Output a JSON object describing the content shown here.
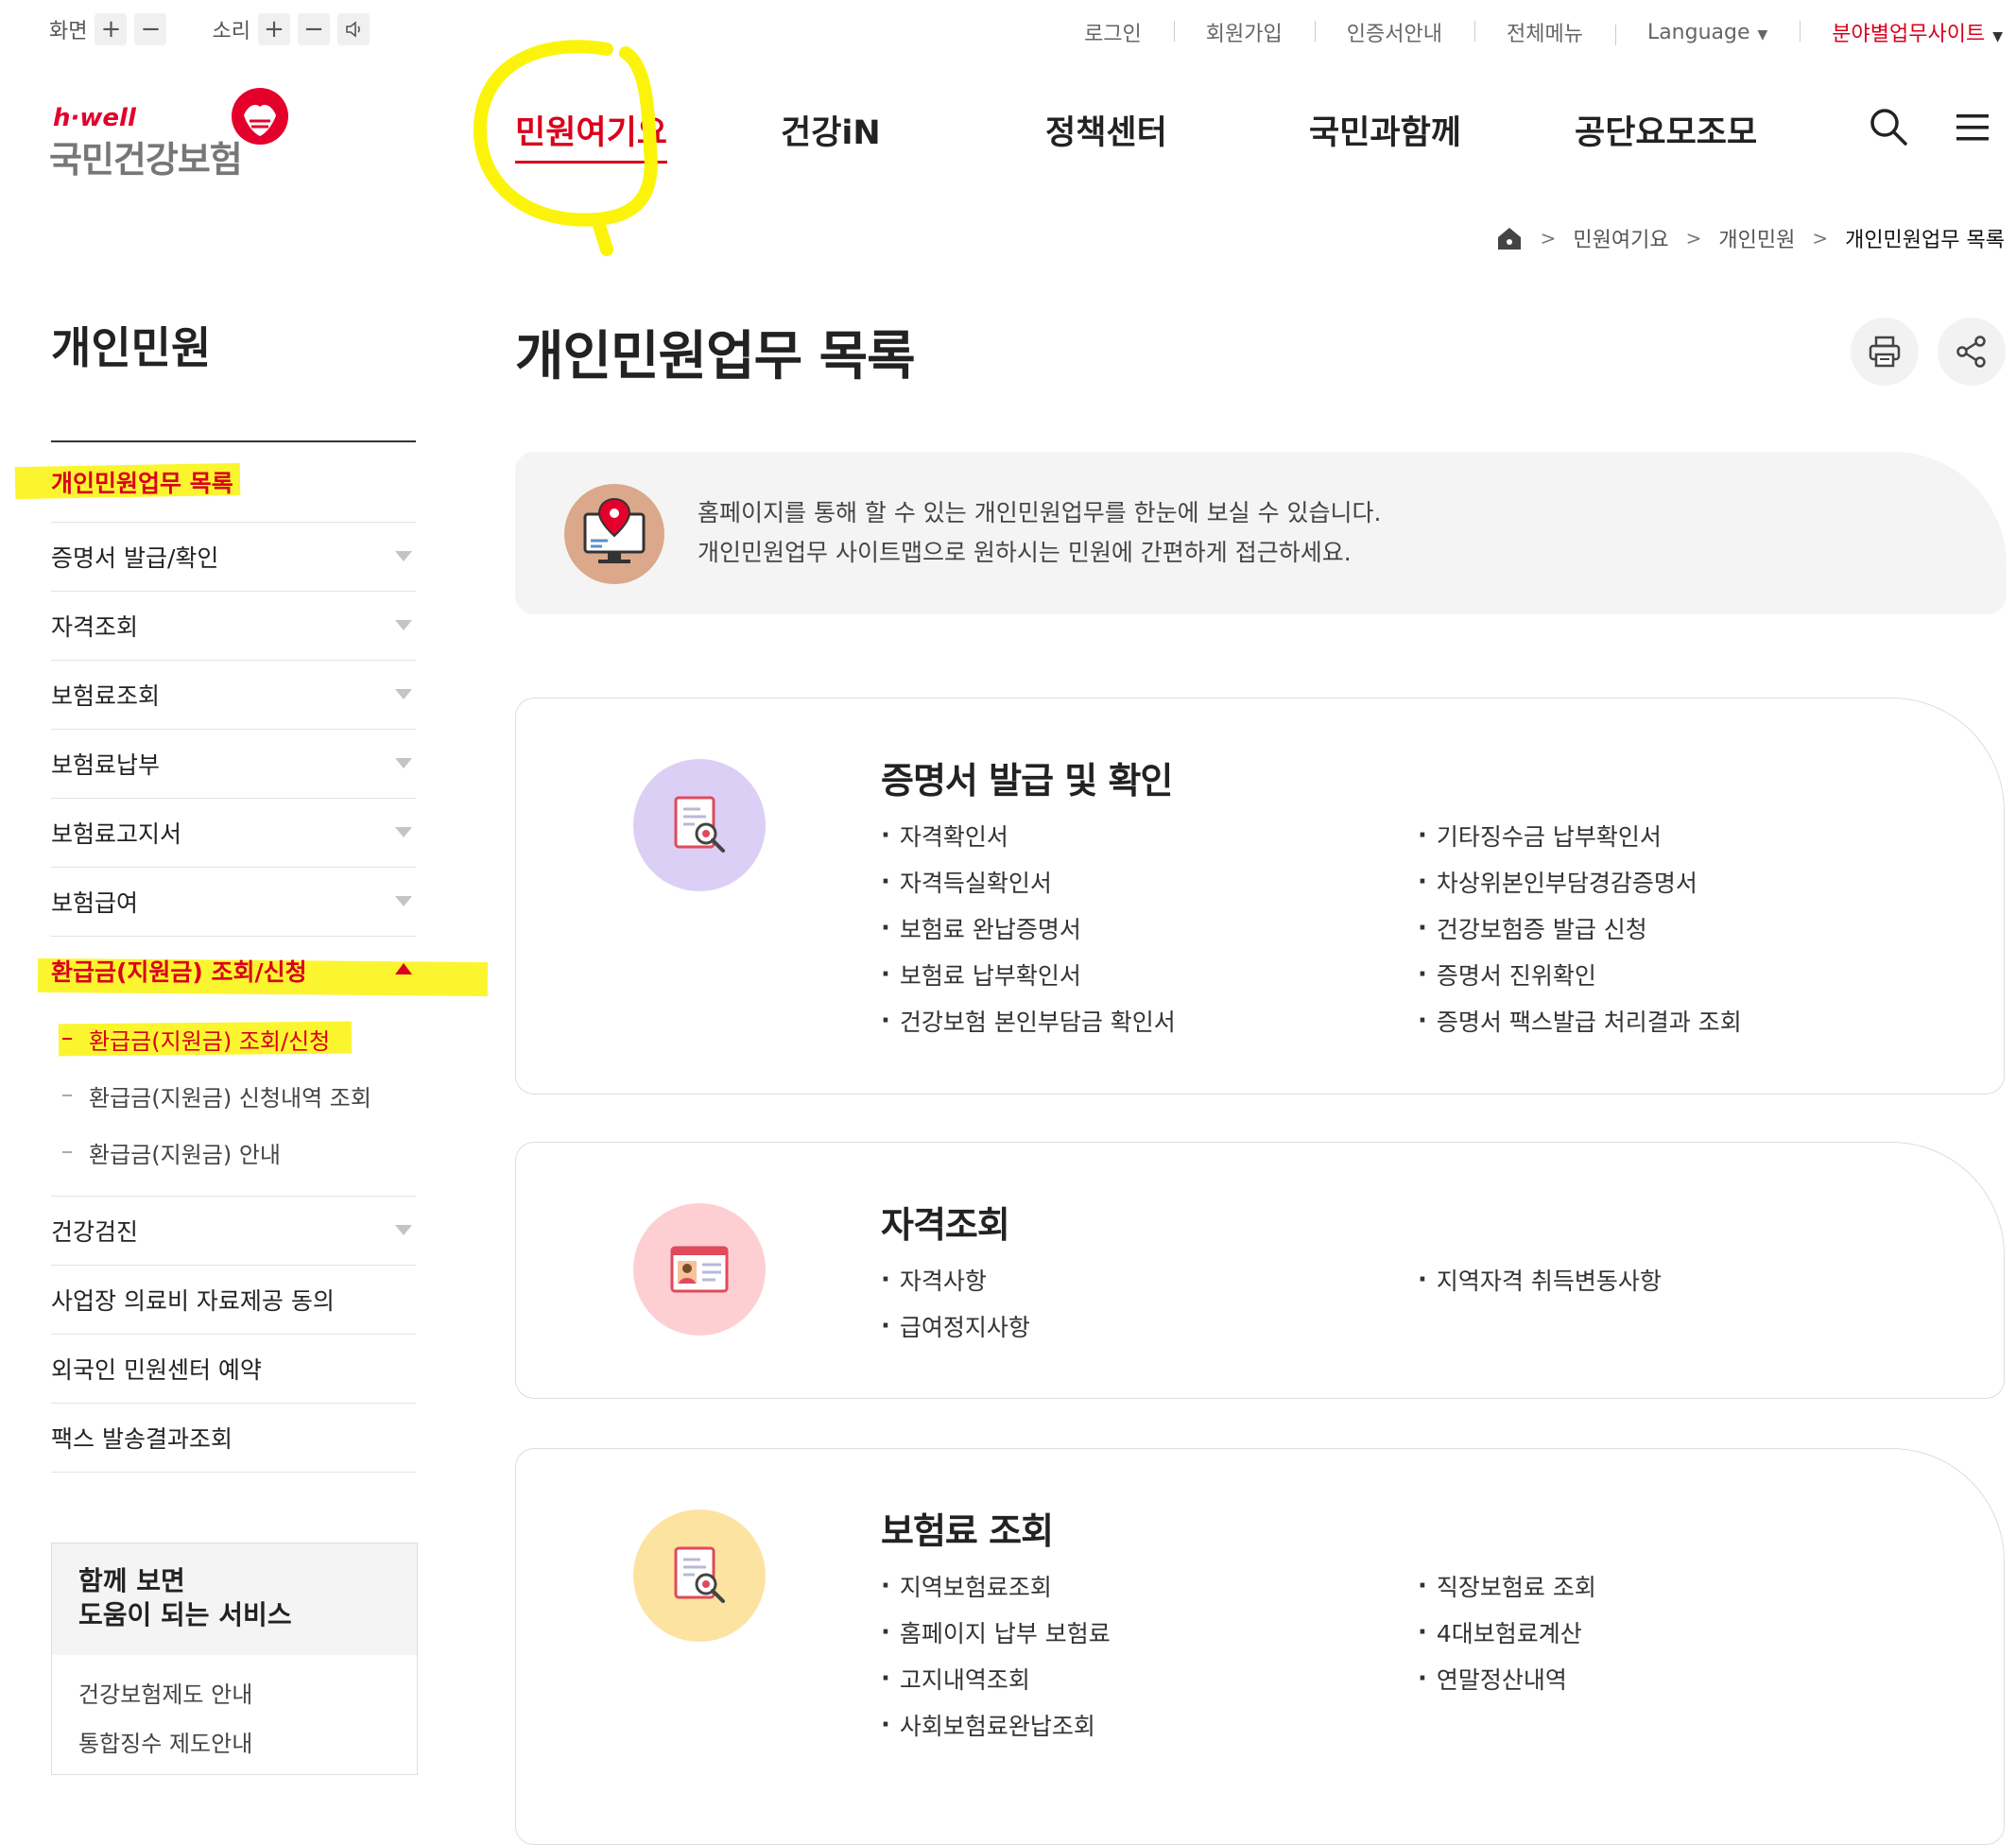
{
  "utility": {
    "screen_label": "화면",
    "sound_label": "소리",
    "links": [
      "로그인",
      "회원가입",
      "인증서안내",
      "전체메뉴"
    ],
    "language_label": "Language",
    "field_sites_label": "분야별업무사이트"
  },
  "logo": {
    "tagline": "h·well",
    "name": "국민건강보험"
  },
  "gnb": {
    "items": [
      "민원여기요",
      "건강iN",
      "정책센터",
      "국민과함께",
      "공단요모조모"
    ],
    "active_index": 0
  },
  "breadcrumb": {
    "items": [
      "민원여기요",
      "개인민원",
      "개인민원업무 목록"
    ]
  },
  "sidebar": {
    "title": "개인민원",
    "items": [
      {
        "label": "개인민원업무 목록",
        "active": true
      },
      {
        "label": "증명서 발급/확인"
      },
      {
        "label": "자격조회"
      },
      {
        "label": "보험료조회"
      },
      {
        "label": "보험료납부"
      },
      {
        "label": "보험료고지서"
      },
      {
        "label": "보험급여"
      },
      {
        "label": "환급금(지원금) 조회/신청",
        "expanded": true
      },
      {
        "label": "건강검진"
      },
      {
        "label": "사업장 의료비 자료제공 동의"
      },
      {
        "label": "외국인 민원센터 예약"
      },
      {
        "label": "팩스 발송결과조회"
      }
    ],
    "subitems": [
      "환급금(지원금) 조회/신청",
      "환급금(지원금) 신청내역 조회",
      "환급금(지원금) 안내"
    ],
    "related": {
      "title_line1": "함께 보면",
      "title_line2": "도움이 되는 서비스",
      "links": [
        "건강보험제도 안내",
        "통합징수 제도안내"
      ]
    }
  },
  "main": {
    "page_title": "개인민원업무 목록",
    "intro_line1": "홈페이지를 통해 할 수 있는 개인민원업무를 한눈에 보실 수 있습니다.",
    "intro_line2": "개인민원업무 사이트맵으로 원하시는 민원에 간편하게 접근하세요.",
    "cards": [
      {
        "title": "증명서 발급 및 확인",
        "icon": "certificate-search-icon",
        "col1": [
          "자격확인서",
          "자격득실확인서",
          "보험료 완납증명서",
          "보험료 납부확인서",
          "건강보험 본인부담금 확인서"
        ],
        "col2": [
          "기타징수금 납부확인서",
          "차상위본인부담경감증명서",
          "건강보험증 발급 신청",
          "증명서 진위확인",
          "증명서 팩스발급 처리결과 조회"
        ]
      },
      {
        "title": "자격조회",
        "icon": "id-card-icon",
        "col1": [
          "자격사항",
          "급여정지사항"
        ],
        "col2": [
          "지역자격 취득변동사항"
        ]
      },
      {
        "title": "보험료 조회",
        "icon": "document-search-icon",
        "col1": [
          "지역보험료조회",
          "홈페이지 납부 보험료",
          "고지내역조회",
          "사회보험료완납조회"
        ],
        "col2": [
          "직장보험료 조회",
          "4대보험료계산",
          "연말정산내역"
        ]
      }
    ]
  },
  "colors": {
    "accent_red": "#d9001b",
    "highlight_yellow": "#fbf40a",
    "card1_icon_bg": "#dccff6",
    "card2_icon_bg": "#fdcfd3",
    "card3_icon_bg": "#fde3a0",
    "intro_icon_bg": "#dba88b"
  }
}
